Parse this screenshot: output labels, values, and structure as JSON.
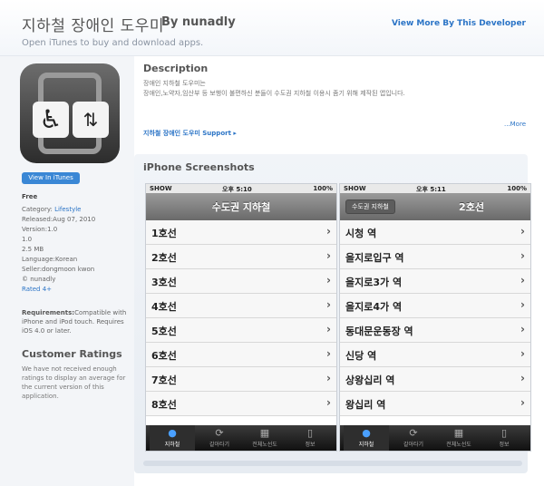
{
  "header": {
    "app_title": "지하철 장애인 도우미",
    "by_developer": "By nunadly",
    "open_itunes": "Open iTunes to buy and download apps.",
    "view_more": "View More By This Developer"
  },
  "left": {
    "view_in_itunes": "View In iTunes",
    "price": "Free",
    "category_label": "Category: ",
    "category": "Lifestyle",
    "released": "Released:Aug 07, 2010",
    "version": "Version:1.0",
    "version_number": "1.0",
    "size": "2.5 MB",
    "language": "Language:Korean",
    "seller": "Seller:dongmoon kwon",
    "copyright": "© nunadly",
    "rated": "Rated 4+",
    "requirements_label": "Requirements:",
    "requirements": "Compatible with iPhone and iPod touch. Requires iOS 4.0 or later.",
    "ratings_title": "Customer Ratings",
    "ratings_text": "We have not received enough ratings to display an average for the current version of this application."
  },
  "description": {
    "title": "Description",
    "line1": "장애인 지하철 도우미는",
    "line2": "장애인,노약자,임산부 등 보행이 불편하신 분들이 수도권 지하철 이용시 좀기 위해 제작된 앱입니다.",
    "more": "...More",
    "support": "지하철 장애인 도우미 Support"
  },
  "screenshots": {
    "title": "iPhone Screenshots",
    "phone1": {
      "carrier": "SHOW",
      "time": "오후 5:10",
      "battery": "100%",
      "nav_title": "수도권 지하철",
      "rows": [
        "1호선",
        "2호선",
        "3호선",
        "4호선",
        "5호선",
        "6호선",
        "7호선",
        "8호선"
      ],
      "tabs": [
        "지하철",
        "갈아타기",
        "전체노선도",
        "정보"
      ]
    },
    "phone2": {
      "carrier": "SHOW",
      "time": "오후 5:11",
      "battery": "100%",
      "back_label": "수도권 지하철",
      "nav_title": "2호선",
      "rows": [
        "시청 역",
        "을지로입구 역",
        "을지로3가 역",
        "을지로4가 역",
        "동대문운동장 역",
        "신당 역",
        "상왕십리 역",
        "왕십리 역"
      ],
      "tabs": [
        "지하철",
        "갈아타기",
        "전체노선도",
        "정보"
      ]
    }
  },
  "icons": {
    "wheelchair": "wheelchair-icon",
    "elevator": "elevator-icon",
    "pin": "map-pin-icon",
    "refresh": "refresh-icon",
    "map": "map-icon",
    "phone": "phone-icon"
  }
}
